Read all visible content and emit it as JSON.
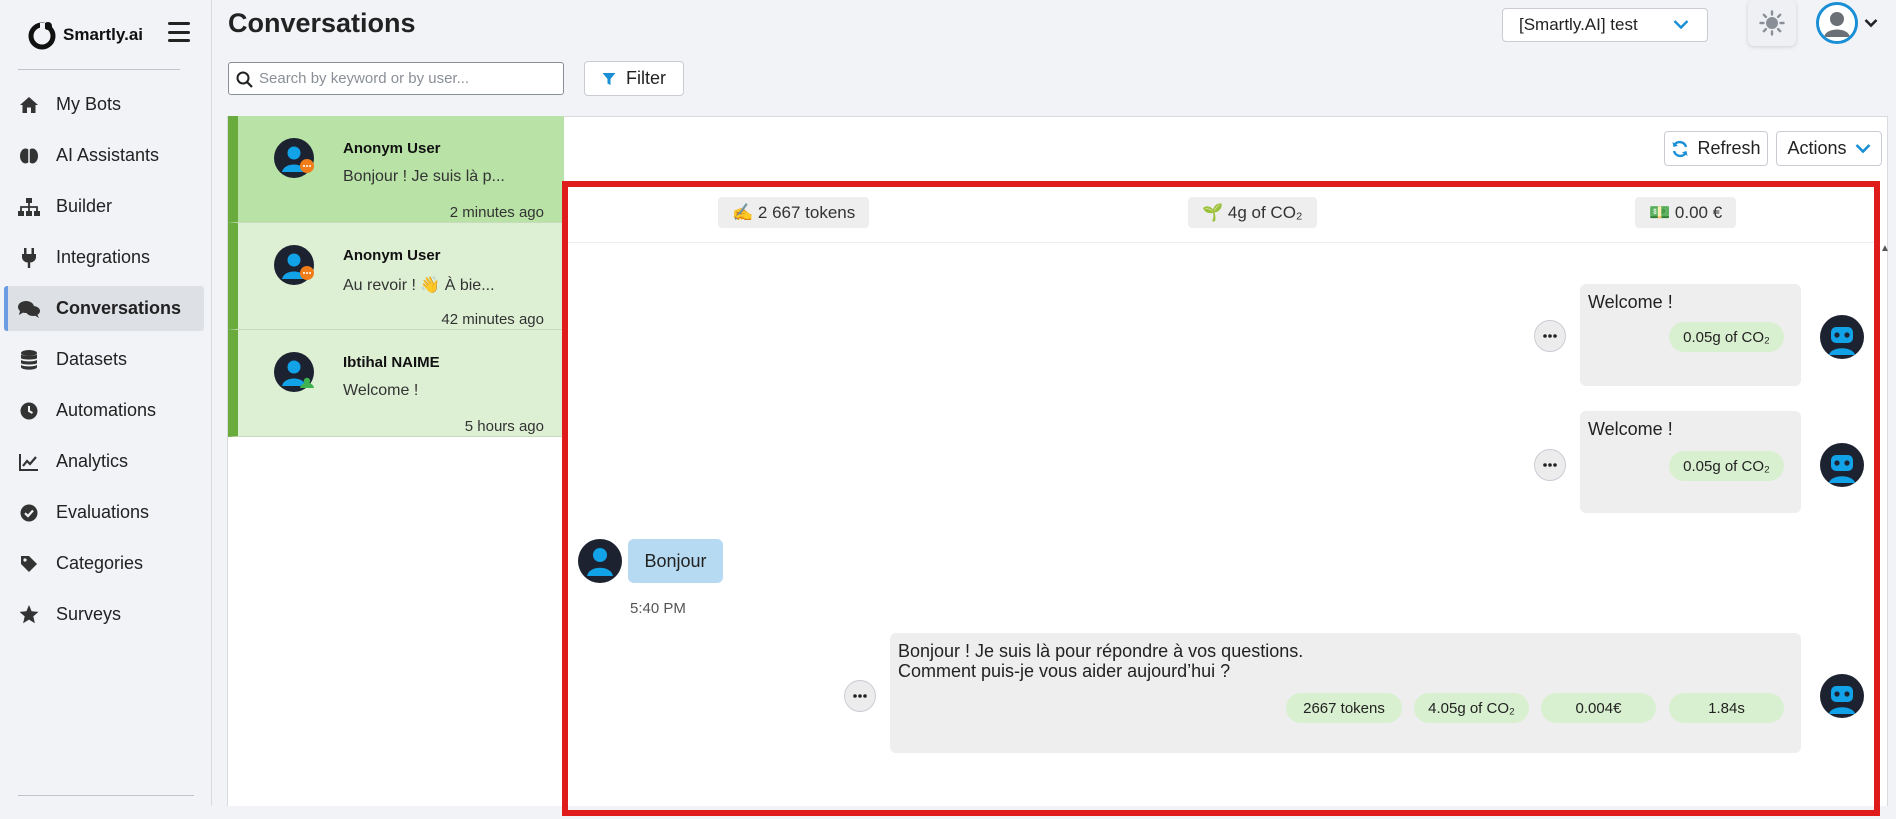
{
  "brand": {
    "name": "Smartly.ai"
  },
  "nav": [
    {
      "label": "My Bots",
      "icon": "home-icon"
    },
    {
      "label": "AI Assistants",
      "icon": "brain-icon"
    },
    {
      "label": "Builder",
      "icon": "sitemap-icon"
    },
    {
      "label": "Integrations",
      "icon": "plug-icon"
    },
    {
      "label": "Conversations",
      "icon": "comments-icon",
      "active": true
    },
    {
      "label": "Datasets",
      "icon": "database-icon"
    },
    {
      "label": "Automations",
      "icon": "clock-icon"
    },
    {
      "label": "Analytics",
      "icon": "chart-line-icon"
    },
    {
      "label": "Evaluations",
      "icon": "check-circle-icon"
    },
    {
      "label": "Categories",
      "icon": "tag-icon"
    },
    {
      "label": "Surveys",
      "icon": "star-icon"
    }
  ],
  "header": {
    "title": "Conversations",
    "bot_selector": "[Smartly.AI] test",
    "search_placeholder": "Search by keyword or by user...",
    "filter_label": "Filter"
  },
  "conversations": [
    {
      "name": "Anonym User",
      "preview": "Bonjour ! Je suis là p...",
      "time": "2 minutes ago",
      "selected": true
    },
    {
      "name": "Anonym User",
      "preview": "Au revoir ! 👋 À bie...",
      "time": "42 minutes ago"
    },
    {
      "name": "Ibtihal NAIME",
      "preview": "Welcome !",
      "time": "5 hours ago"
    }
  ],
  "chat": {
    "refresh_label": "Refresh",
    "actions_label": "Actions",
    "stats": {
      "tokens": "✍️ 2 667 tokens",
      "co2": "🌱 4g of CO₂",
      "cost": "💵 0.00 €"
    },
    "messages": [
      {
        "from": "bot",
        "text": "Welcome !",
        "co2": "0.05g of CO₂"
      },
      {
        "from": "bot",
        "text": "Welcome !",
        "co2": "0.05g of CO₂"
      },
      {
        "from": "user",
        "text": "Bonjour",
        "time": "5:40 PM"
      },
      {
        "from": "bot",
        "line1": "Bonjour ! Je suis là pour répondre à vos questions.",
        "line2": "Comment puis-je vous aider aujourd’hui ?",
        "tokens": "2667 tokens",
        "co2": "4.05g of CO₂",
        "cost": "0.004€",
        "duration": "1.84s"
      }
    ]
  },
  "colors": {
    "accent": "#1a8fd6",
    "highlight": "#e01b1b",
    "conv_green": "#6aab3e",
    "pill_green": "#d9f0d0",
    "user_bubble": "#b6daf1"
  }
}
